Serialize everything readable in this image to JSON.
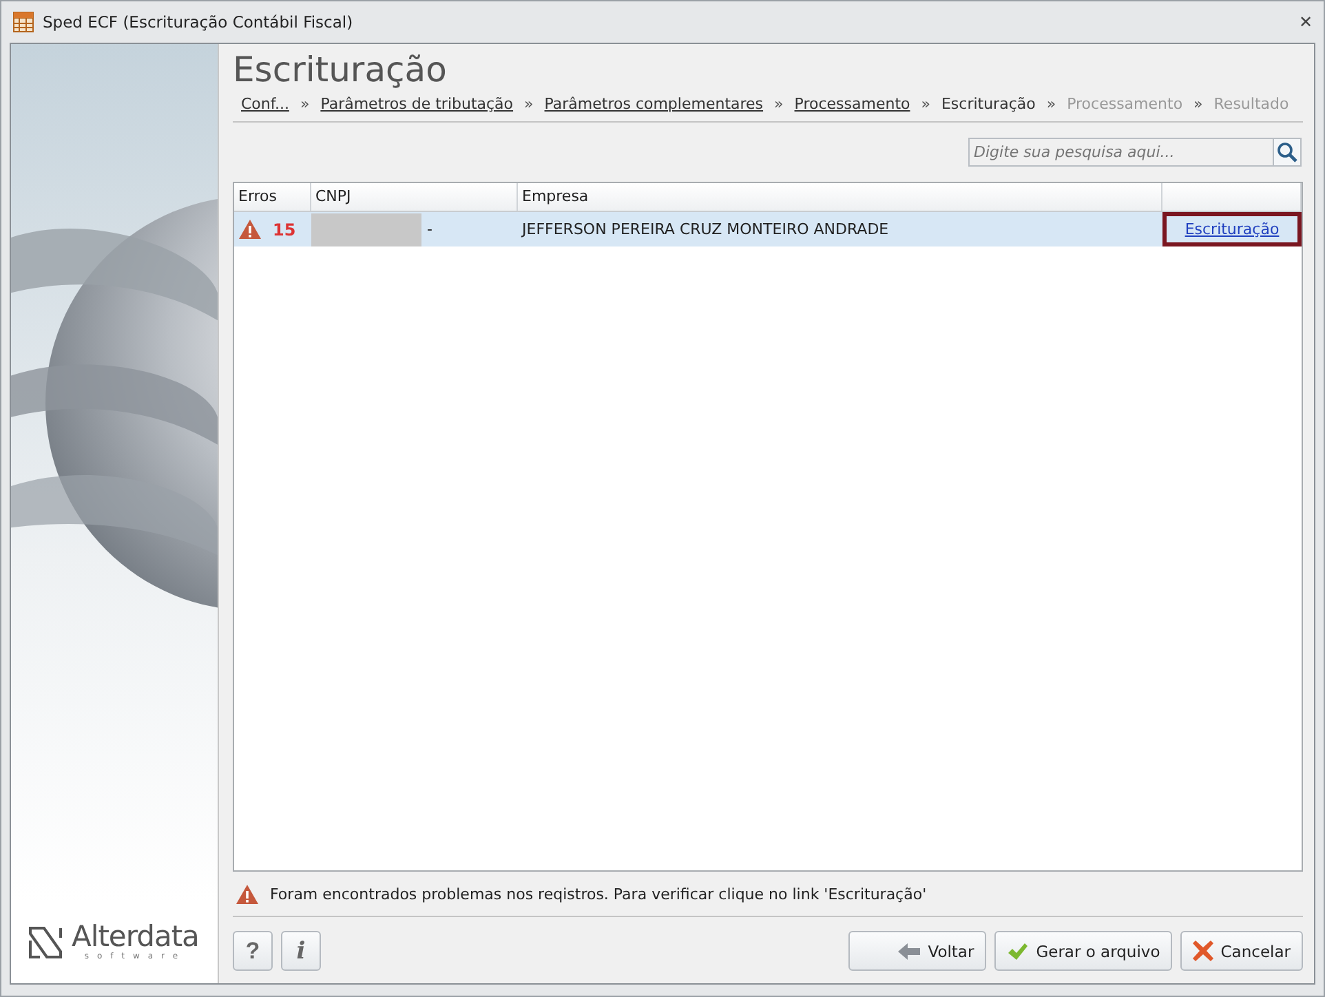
{
  "window": {
    "title": "Sped ECF (Escrituração Contábil Fiscal)",
    "close": "✕"
  },
  "sidebar": {
    "logo": {
      "name": "Alterdata",
      "tagline": "software"
    }
  },
  "page": {
    "title": "Escrituração",
    "separator": "»",
    "breadcrumbs": [
      {
        "label": "Conf...",
        "kind": "link"
      },
      {
        "label": "Parâmetros de tributação",
        "kind": "link"
      },
      {
        "label": "Parâmetros complementares",
        "kind": "link"
      },
      {
        "label": "Processamento",
        "kind": "link"
      },
      {
        "label": "Escrituração",
        "kind": "current"
      },
      {
        "label": "Processamento",
        "kind": "pending"
      },
      {
        "label": "Resultado",
        "kind": "pending"
      }
    ]
  },
  "search": {
    "placeholder": "Digite sua pesquisa aqui..."
  },
  "table": {
    "columns": [
      "Erros",
      "CNPJ",
      "Empresa"
    ],
    "rows": [
      {
        "errors": "15",
        "cnpj": "-",
        "company": "JEFFERSON PEREIRA CRUZ MONTEIRO ANDRADE",
        "link": "Escrituração",
        "selected": true,
        "link_focused": true
      }
    ]
  },
  "message": "Foram encontrados problemas nos reqistros. Para verificar clique no link 'Escrituração'",
  "footer": {
    "help": "?",
    "info": "i",
    "buttons": [
      {
        "label": "Voltar",
        "kind": "back"
      },
      {
        "label": "Gerar o arquivo",
        "kind": "ok"
      },
      {
        "label": "Cancelar",
        "kind": "cancel"
      }
    ]
  }
}
